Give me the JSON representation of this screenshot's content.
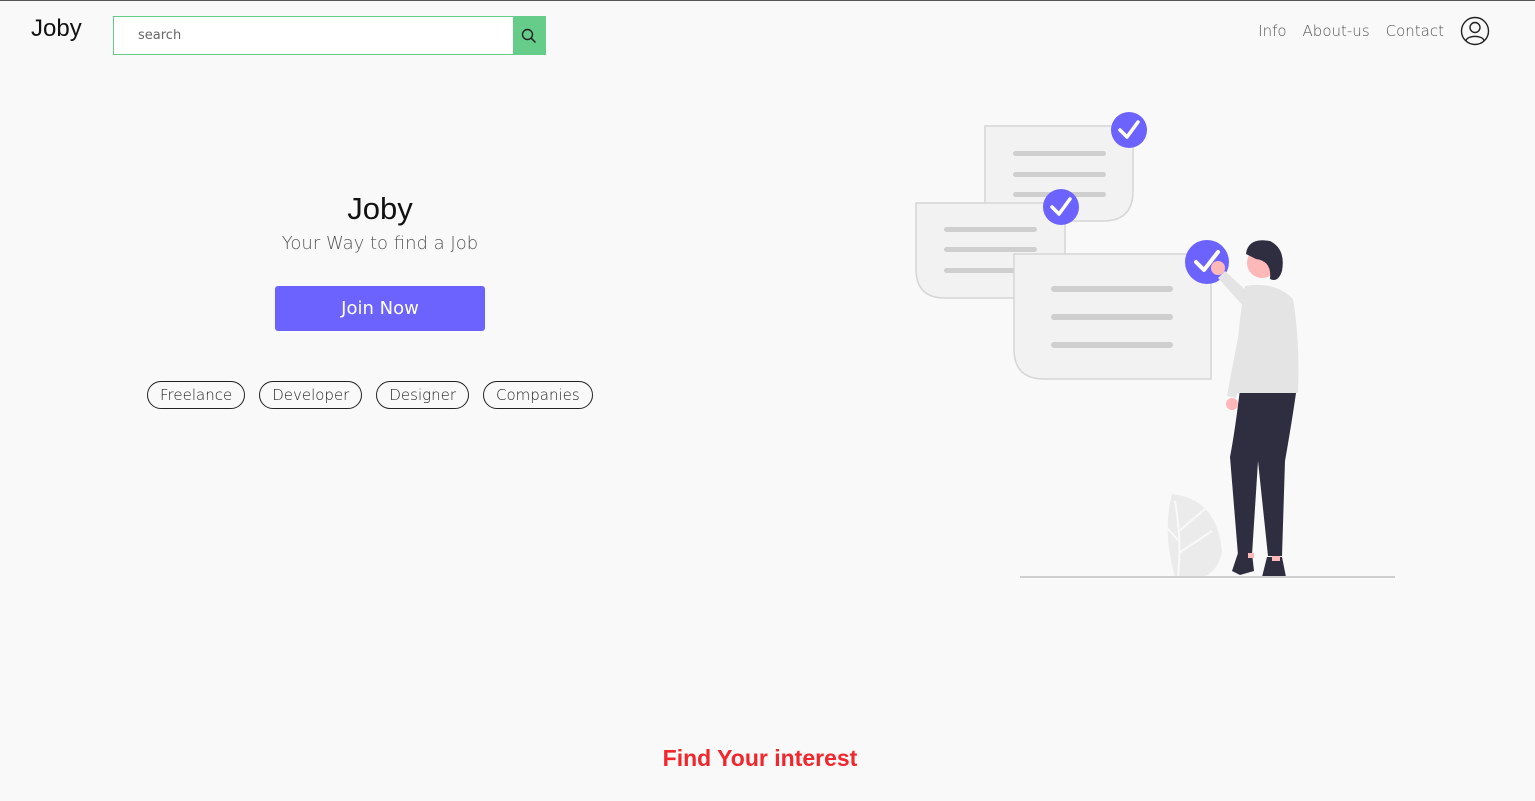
{
  "navbar": {
    "brand": "Joby",
    "search": {
      "placeholder": "search"
    },
    "links": [
      "Info",
      "About-us",
      "Contact"
    ]
  },
  "hero": {
    "title": "Joby",
    "subtitle": "Your Way to find a Job",
    "cta_label": "Join Now",
    "tags": [
      "Freelance",
      "Developer",
      "Designer",
      "Companies"
    ]
  },
  "section": {
    "heading": "Find Your interest"
  },
  "colors": {
    "accent": "#6c63ff",
    "search_green": "#66cc8a",
    "heading_red": "#f1272d"
  },
  "icons": {
    "search": "search-icon",
    "user": "user-circle-icon",
    "check": "check-circle-icon"
  }
}
